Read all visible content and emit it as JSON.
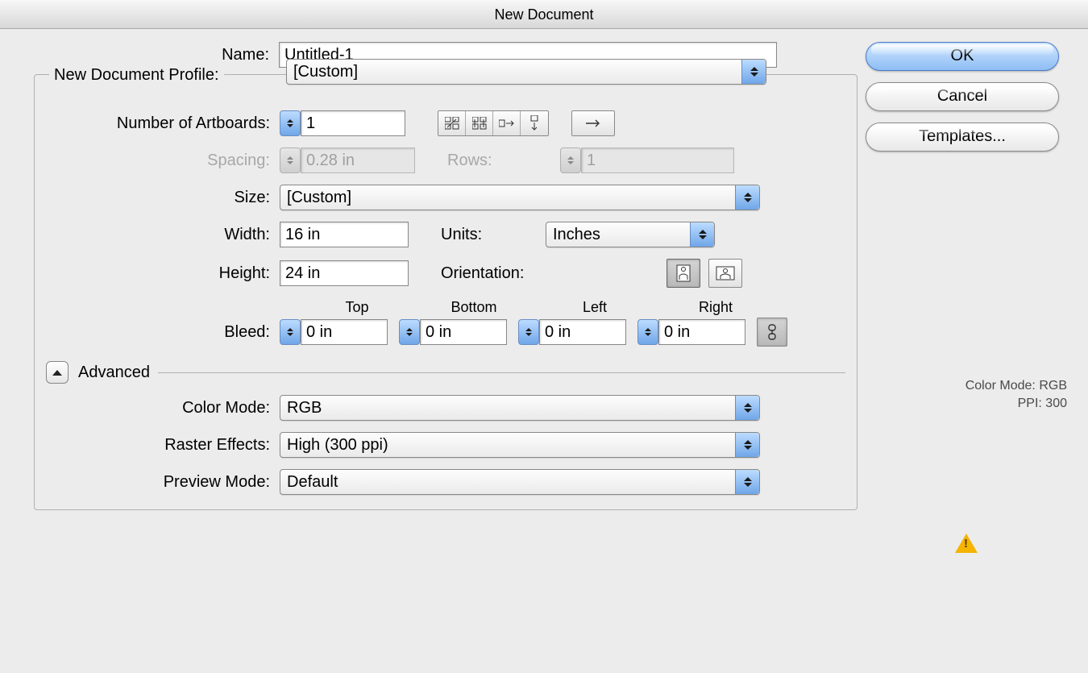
{
  "title": "New Document",
  "labels": {
    "name": "Name:",
    "profile": "New Document Profile:",
    "num_artboards": "Number of Artboards:",
    "spacing": "Spacing:",
    "rows": "Rows:",
    "size": "Size:",
    "width": "Width:",
    "height": "Height:",
    "units": "Units:",
    "orientation": "Orientation:",
    "bleed": "Bleed:",
    "top": "Top",
    "bottom": "Bottom",
    "left": "Left",
    "right": "Right",
    "advanced": "Advanced",
    "color_mode": "Color Mode:",
    "raster_effects": "Raster Effects:",
    "preview_mode": "Preview Mode:"
  },
  "values": {
    "name": "Untitled-1",
    "profile": "[Custom]",
    "num_artboards": "1",
    "spacing": "0.28 in",
    "rows": "1",
    "size": "[Custom]",
    "width": "16 in",
    "height": "24 in",
    "units": "Inches",
    "bleed_top": "0 in",
    "bleed_bottom": "0 in",
    "bleed_left": "0 in",
    "bleed_right": "0 in",
    "color_mode": "RGB",
    "raster_effects": "High (300 ppi)",
    "preview_mode": "Default"
  },
  "buttons": {
    "ok": "OK",
    "cancel": "Cancel",
    "templates": "Templates..."
  },
  "meta": {
    "color_mode_label": "Color Mode:",
    "color_mode_value": "RGB",
    "ppi_label": "PPI:",
    "ppi_value": "300"
  }
}
